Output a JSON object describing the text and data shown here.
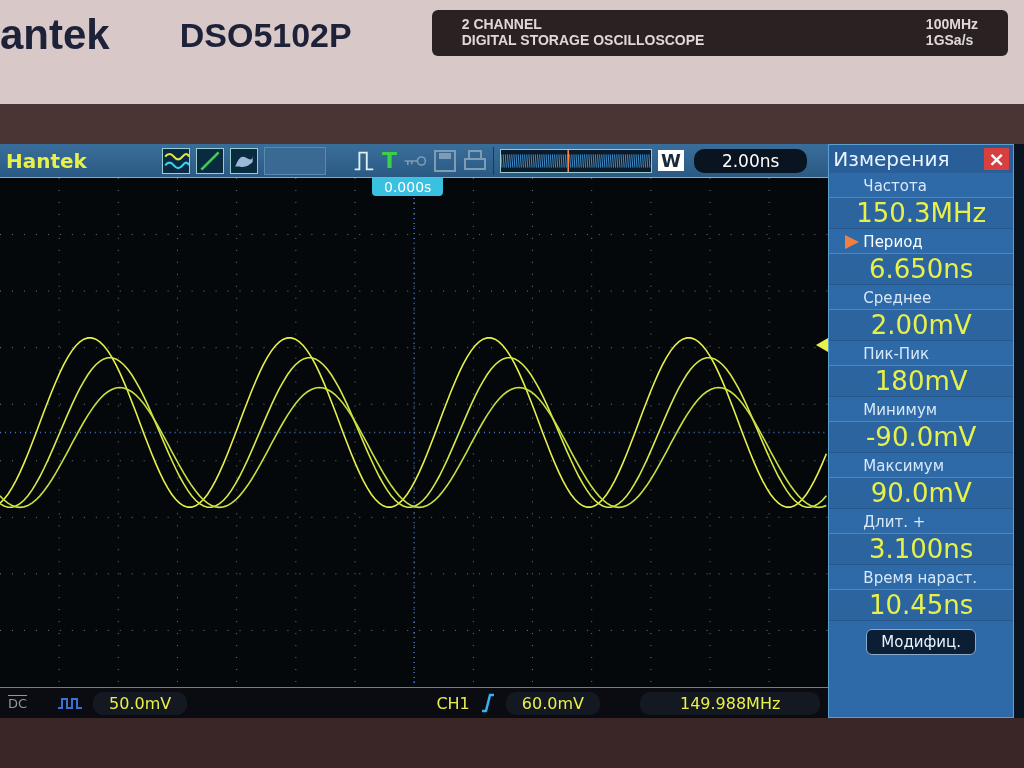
{
  "device": {
    "brand": "antek",
    "model": "DSO5102P",
    "badge_line_1": "2 CHANNEL",
    "badge_line_2": "DIGITAL STORAGE OSCILLOSCOPE",
    "spec_1": "100MHz",
    "spec_2": "1GSa/s"
  },
  "toolbar": {
    "logo": "Hantek",
    "trigger_letter": "T",
    "mode": "W",
    "timebase": "2.00ns",
    "trigger_time": "0.000s"
  },
  "measurements": {
    "title": "Измерения",
    "close": "×",
    "items": [
      {
        "label": "Частота",
        "value": "150.3MHz",
        "selected": false
      },
      {
        "label": "Период",
        "value": "6.650ns",
        "selected": true
      },
      {
        "label": "Среднее",
        "value": "2.00mV",
        "selected": false
      },
      {
        "label": "Пик-Пик",
        "value": "180mV",
        "selected": false
      },
      {
        "label": "Минимум",
        "value": "-90.0mV",
        "selected": false
      },
      {
        "label": "Максимум",
        "value": "90.0mV",
        "selected": false
      },
      {
        "label": "Длит. +",
        "value": "3.100ns",
        "selected": false
      },
      {
        "label": "Время нараст.",
        "value": "10.45ns",
        "selected": false
      }
    ],
    "button": "Модифиц."
  },
  "status_bar": {
    "coupling": "DC",
    "ch_scale": "50.0mV",
    "trigger_channel": "CH1",
    "trigger_level": "60.0mV",
    "frequency": "149.988MHz"
  }
}
